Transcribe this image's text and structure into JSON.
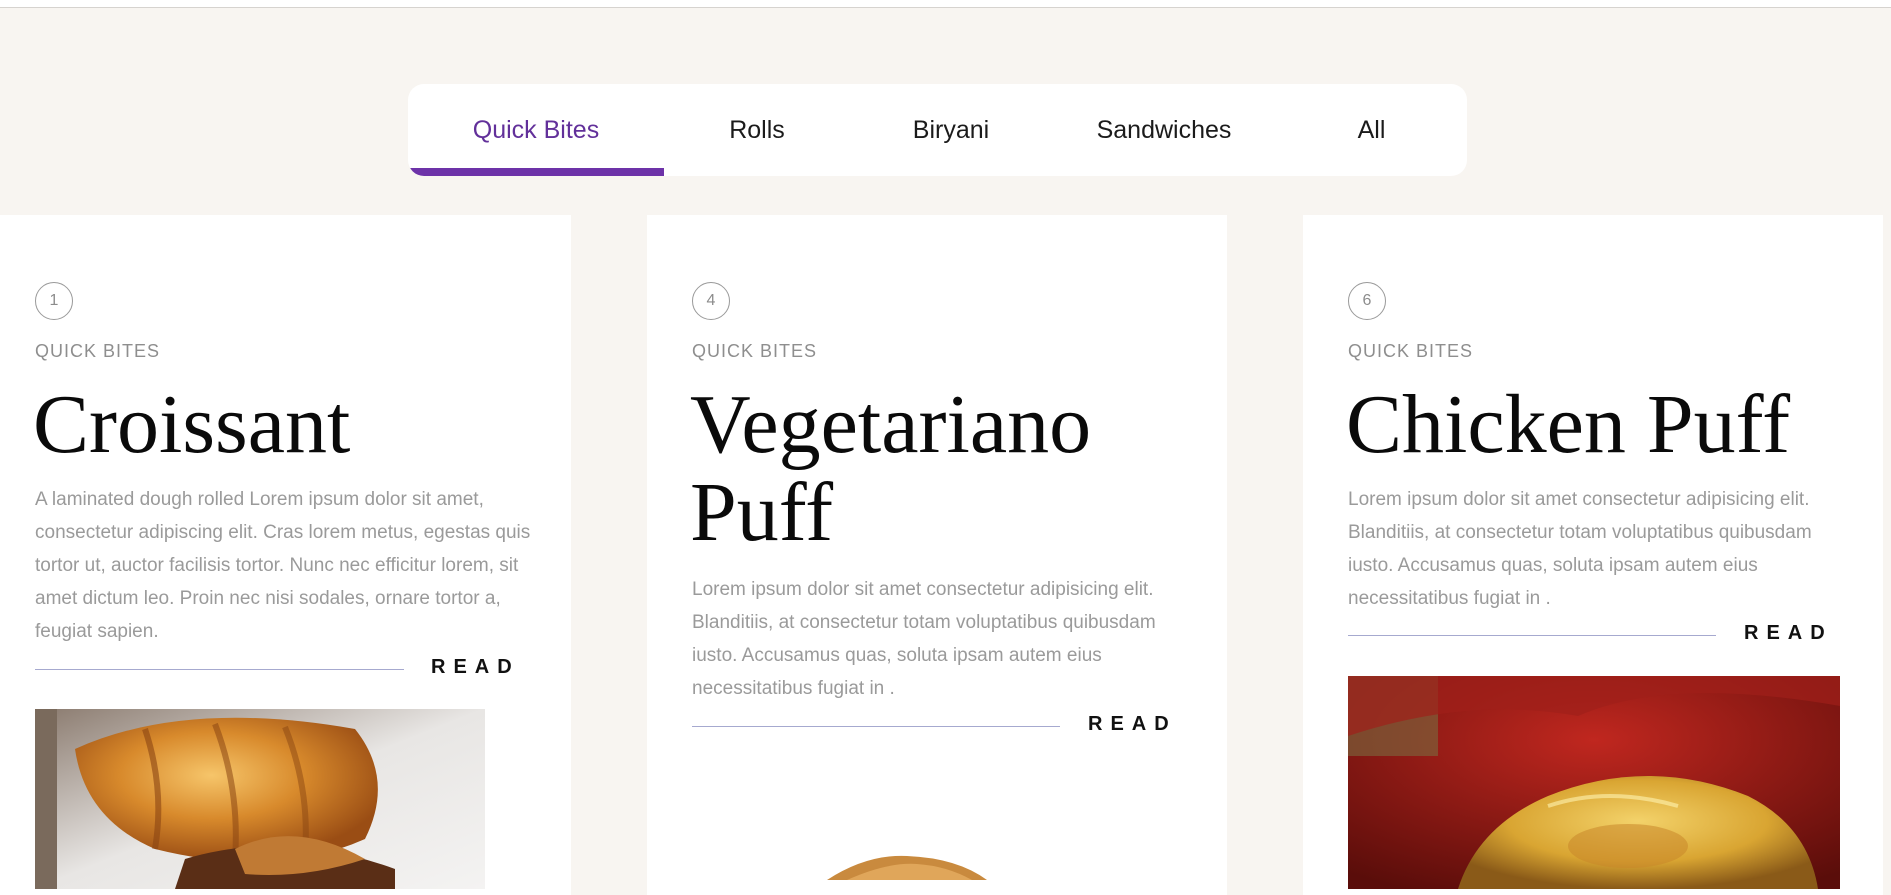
{
  "tabs": [
    {
      "label": "Quick Bites",
      "active": true
    },
    {
      "label": "Rolls",
      "active": false
    },
    {
      "label": "Biryani",
      "active": false
    },
    {
      "label": "Sandwiches",
      "active": false
    },
    {
      "label": "All",
      "active": false
    }
  ],
  "colors": {
    "accent": "#6d32a8",
    "background": "#f8f5f1",
    "card": "#ffffff",
    "rule": "#a6a9cf"
  },
  "cards": [
    {
      "number": "1",
      "category": "QUICK BITES",
      "title": "Croissant",
      "description": "A laminated dough rolled Lorem ipsum dolor sit amet, consectetur adipiscing elit. Cras lorem metus, egestas quis tortor ut, auctor facilisis tortor. Nunc nec efficitur lorem, sit amet dictum leo. Proin nec nisi sodales, ornare tortor a, feugiat sapien.",
      "read_label": "READ",
      "image": "croissant-photo"
    },
    {
      "number": "4",
      "category": "QUICK BITES",
      "title": "Vegetariano Puff",
      "description": "Lorem ipsum dolor sit amet consectetur adipisicing elit. Blanditiis, at consectetur totam voluptatibus quibusdam iusto. Accusamus quas, soluta ipsam autem eius necessitatibus fugiat in .",
      "read_label": "READ",
      "image": "vegetarian-puff-photo"
    },
    {
      "number": "6",
      "category": "QUICK BITES",
      "title": "Chicken Puff",
      "description": "Lorem ipsum dolor sit amet consectetur adipisicing elit. Blanditiis, at consectetur totam voluptatibus quibusdam iusto. Accusamus quas, soluta ipsam autem eius necessitatibus fugiat in .",
      "read_label": "READ",
      "image": "chicken-puff-photo"
    }
  ]
}
